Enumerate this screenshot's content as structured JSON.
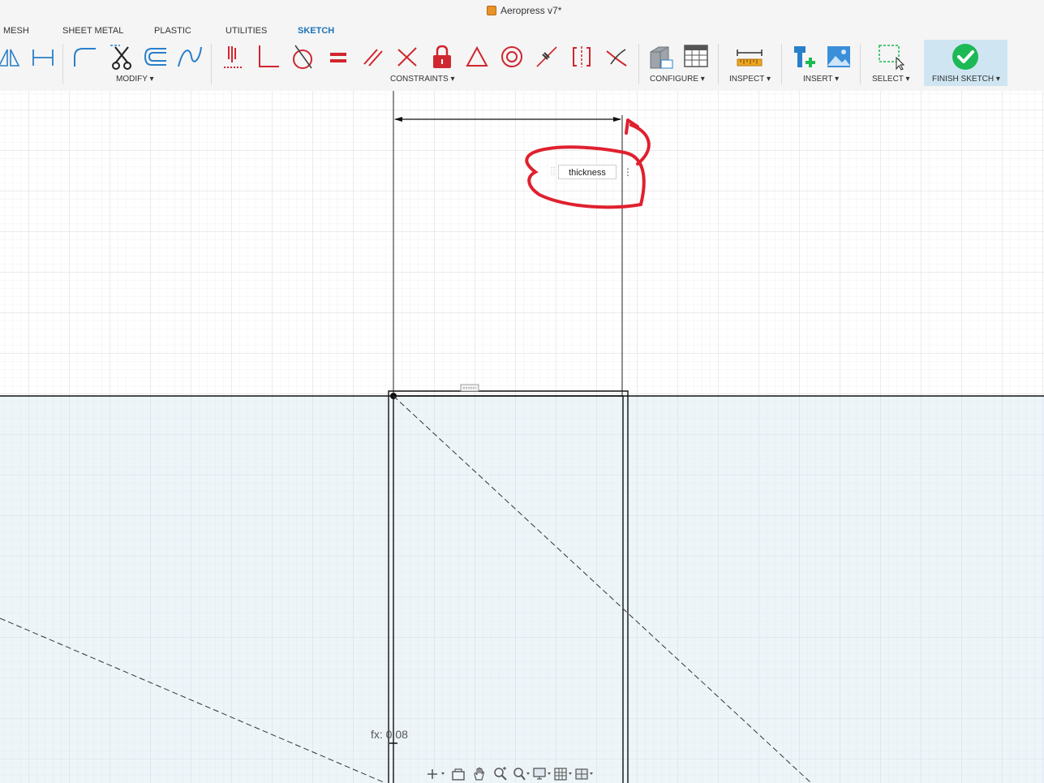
{
  "window": {
    "title": "Aeropress v7*"
  },
  "tabs": [
    {
      "label": "MESH"
    },
    {
      "label": "SHEET METAL"
    },
    {
      "label": "PLASTIC"
    },
    {
      "label": "UTILITIES"
    },
    {
      "label": "SKETCH",
      "active": true
    }
  ],
  "toolbar": {
    "groups": {
      "modify": "MODIFY ▾",
      "constraints": "CONSTRAINTS ▾",
      "configure": "CONFIGURE ▾",
      "inspect": "INSPECT ▾",
      "insert": "INSERT ▾",
      "select": "SELECT ▾",
      "finish": "FINISH SKETCH ▾"
    }
  },
  "canvas": {
    "dimension_input": {
      "value": "thickness"
    },
    "formula_label": "fx: 0.08"
  },
  "colors": {
    "accent": "#2196d8",
    "constraint_red": "#d0262f",
    "finish_green": "#1db954",
    "annotation_red": "#e0202e"
  }
}
